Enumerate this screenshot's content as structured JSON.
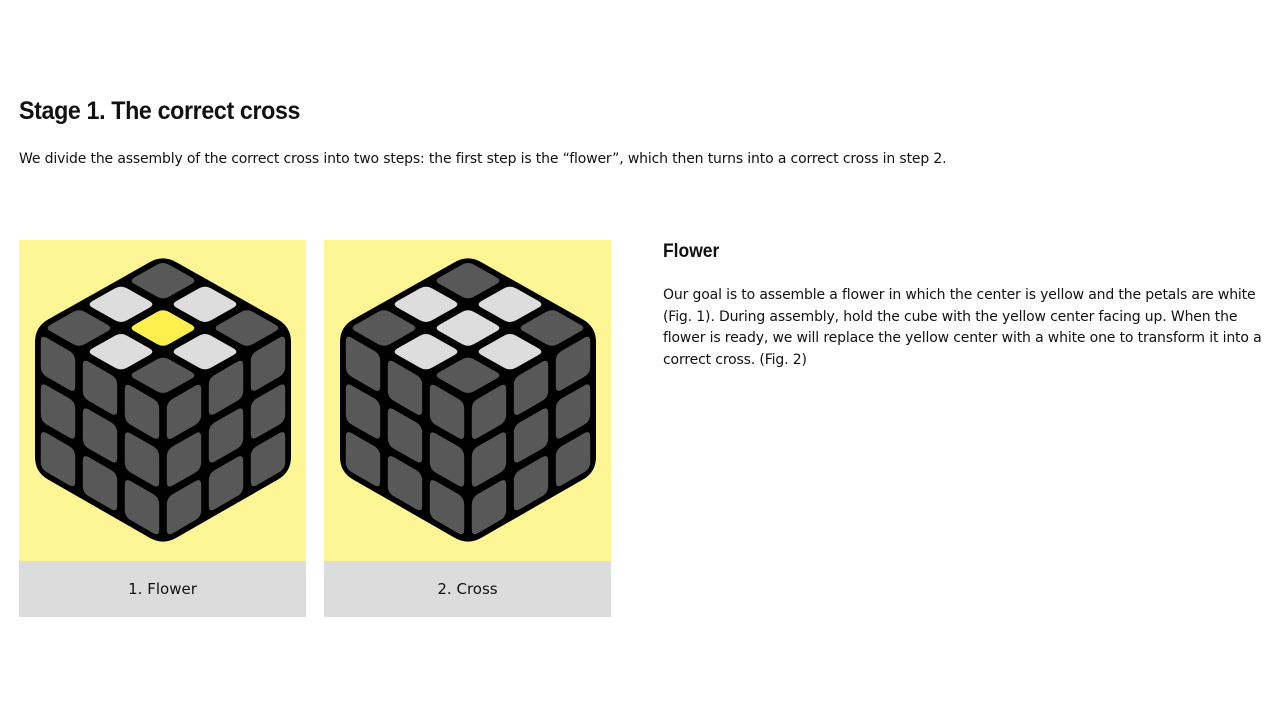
{
  "page": {
    "title": "Stage 1. The correct cross",
    "intro": "We divide the assembly of the correct cross into two steps: the first step is the “flower”, which then turns into a correct cross in step 2."
  },
  "figures": [
    {
      "caption": "1. Flower",
      "top_face": [
        [
          "dark",
          "white",
          "dark"
        ],
        [
          "white",
          "yellow",
          "white"
        ],
        [
          "dark",
          "white",
          "dark"
        ]
      ]
    },
    {
      "caption": "2. Cross",
      "top_face": [
        [
          "dark",
          "white",
          "dark"
        ],
        [
          "white",
          "white",
          "white"
        ],
        [
          "dark",
          "white",
          "dark"
        ]
      ]
    }
  ],
  "flower_section": {
    "heading": "Flower",
    "text": "Our goal is to assemble a flower in which the center is yellow and the petals are white (Fig. 1). During assembly, hold the cube with the yellow center facing up. When the flower is ready, we will replace the yellow center with a white one to transform it into a correct cross. (Fig. 2)"
  },
  "colors": {
    "figure_background": "#fef695",
    "caption_background": "#dcdcdc",
    "cube_body": "#000000",
    "sticker_dark": "#585858",
    "sticker_white": "#dddddd",
    "sticker_yellow": "#fdf04c"
  }
}
